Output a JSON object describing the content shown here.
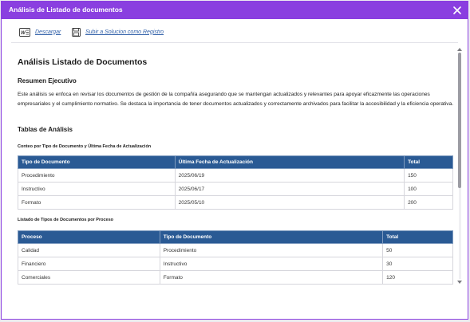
{
  "window": {
    "title": "Análisis de Listado de documentos",
    "accent_color": "#8a3fe0",
    "close_icon": "close-icon"
  },
  "toolbar": {
    "download_label": "Descargar",
    "download_icon": "word-document-icon",
    "save_label": "Subir a Solucion como Registro",
    "save_icon": "floppy-disk-icon"
  },
  "report": {
    "title": "Análisis Listado de Documentos",
    "summary_heading": "Resumen Ejecutivo",
    "summary_text": "Este análisis se enfoca en revisar los documentos de gestión de la compañía asegurando que se mantengan actualizados y relevantes para apoyar eficazmente las operaciones empresariales y el cumplimiento normativo. Se destaca la importancia de tener documentos actualizados y correctamente archivados para facilitar la accesibilidad y la eficiencia operativa.",
    "tables_heading": "Tablas de Análisis",
    "table1": {
      "caption": "Conteo por Tipo de Documento y Última Fecha de Actualización",
      "headers": [
        "Tipo de Documento",
        "Última Fecha de Actualización",
        "Total"
      ],
      "rows": [
        [
          "Procedimiento",
          "2025/06/19",
          "150"
        ],
        [
          "Instructivo",
          "2025/06/17",
          "100"
        ],
        [
          "Formato",
          "2025/05/10",
          "200"
        ]
      ]
    },
    "table2": {
      "caption": "Listado de Tipos de Documentos por Proceso",
      "headers": [
        "Proceso",
        "Tipo de Documento",
        "Total"
      ],
      "rows": [
        [
          "Calidad",
          "Procedimiento",
          "50"
        ],
        [
          "Financiero",
          "Instructivo",
          "30"
        ],
        [
          "Comerciales",
          "Formato",
          "120"
        ]
      ]
    },
    "header_color": "#2a5a94"
  }
}
